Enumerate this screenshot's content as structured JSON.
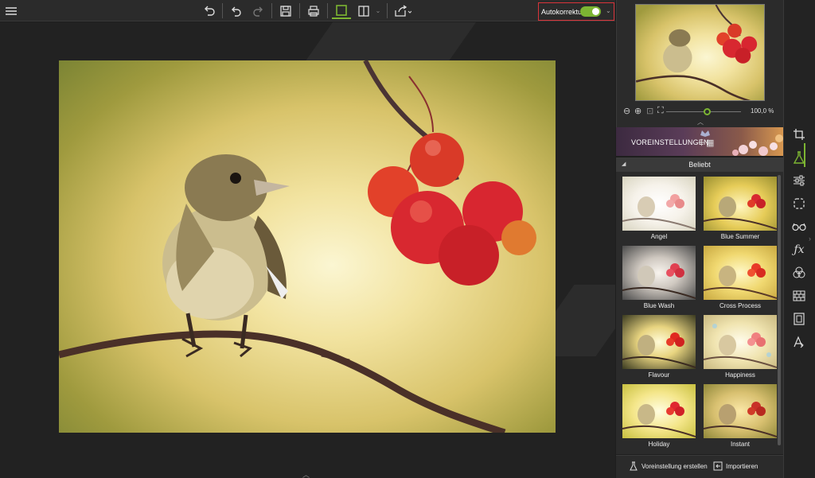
{
  "toolbar": {
    "icons": [
      "menu-icon",
      "undo-all-icon",
      "undo-icon",
      "redo-icon",
      "save-icon",
      "print-icon",
      "single-view-icon",
      "compare-view-icon",
      "share-icon"
    ],
    "autokorrektur_label": "Autokorrektur",
    "autokorrektur_on": true,
    "accent": "#7cb532",
    "highlight": "#d9343a"
  },
  "navigator": {
    "zoom_percent": "100,0 %",
    "zoom_level": 0.5
  },
  "presets_panel": {
    "banner_title": "VOREINSTELLUNGEN",
    "section_title": "Beliebt",
    "items": [
      {
        "label": "Angel",
        "tone": "angel"
      },
      {
        "label": "Blue Summer",
        "tone": "bluesummer"
      },
      {
        "label": "Blue Wash",
        "tone": "bluewash"
      },
      {
        "label": "Cross Process",
        "tone": "crossprocess"
      },
      {
        "label": "Flavour",
        "tone": "flavour"
      },
      {
        "label": "Happiness",
        "tone": "happiness"
      },
      {
        "label": "Holiday",
        "tone": "holiday"
      },
      {
        "label": "Instant",
        "tone": "instant"
      }
    ],
    "create_label": "Voreinstellung erstellen",
    "import_label": "Importieren"
  },
  "side_rail": {
    "icons": [
      "crop-icon",
      "flask-presets-icon",
      "sliders-icon",
      "selection-icon",
      "glasses-icon",
      "fx-icon",
      "color-circles-icon",
      "texture-grid-icon",
      "frame-icon",
      "text-icon"
    ],
    "active": "flask-presets-icon"
  }
}
